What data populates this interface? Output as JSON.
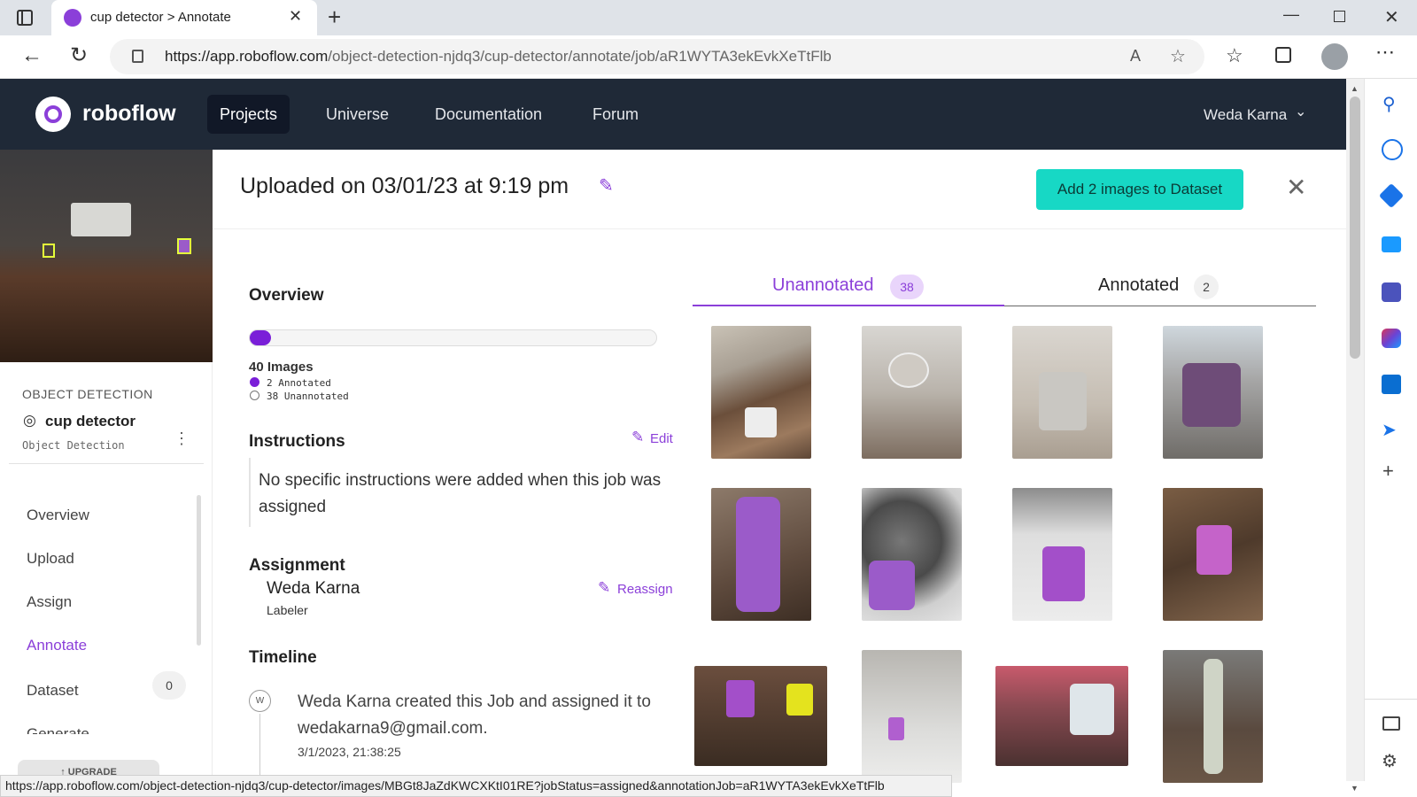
{
  "browser": {
    "tab_title": "cup detector > Annotate",
    "url_host": "https://app.roboflow.com",
    "url_path": "/object-detection-njdq3/cup-detector/annotate/job/aR1WYTA3ekEvkXeTtFlb",
    "status_url": "https://app.roboflow.com/object-detection-njdq3/cup-detector/images/MBGt8JaZdKWCXKtI01RE?jobStatus=assigned&annotationJob=aR1WYTA3ekEvkXeTtFlb"
  },
  "topnav": {
    "brand": "roboflow",
    "links": [
      "Projects",
      "Universe",
      "Documentation",
      "Forum"
    ],
    "user": "Weda Karna"
  },
  "sidebar": {
    "section": "OBJECT DETECTION",
    "project_name": "cup detector",
    "project_type": "Object Detection",
    "items": [
      {
        "label": "Overview"
      },
      {
        "label": "Upload"
      },
      {
        "label": "Assign"
      },
      {
        "label": "Annotate"
      },
      {
        "label": "Dataset",
        "badge": "0"
      },
      {
        "label": "Generate"
      }
    ],
    "upgrade": "↑ UPGRADE"
  },
  "job": {
    "title": "Uploaded on 03/01/23 at 9:19 pm",
    "add_button": "Add 2 images to Dataset"
  },
  "overview": {
    "heading": "Overview",
    "images_label": "40 Images",
    "annotated_label": "2 Annotated",
    "unannotated_label": "38 Unannotated",
    "progress": 0.05
  },
  "instructions": {
    "heading": "Instructions",
    "edit": "Edit",
    "text": "No specific instructions were added when this job was assigned"
  },
  "assignment": {
    "heading": "Assignment",
    "name": "Weda Karna",
    "role": "Labeler",
    "reassign": "Reassign"
  },
  "timeline": {
    "heading": "Timeline",
    "avatar": "W",
    "text": "Weda Karna created this Job and assigned it to wedakarna9@gmail.com.",
    "timestamp": "3/1/2023, 21:38:25"
  },
  "tabs": {
    "unannotated": "Unannotated",
    "unannotated_count": "38",
    "annotated": "Annotated",
    "annotated_count": "2"
  },
  "colors": {
    "accent": "#8b3fd9",
    "nav_bg": "#1f2937",
    "cta": "#17d8c5"
  }
}
